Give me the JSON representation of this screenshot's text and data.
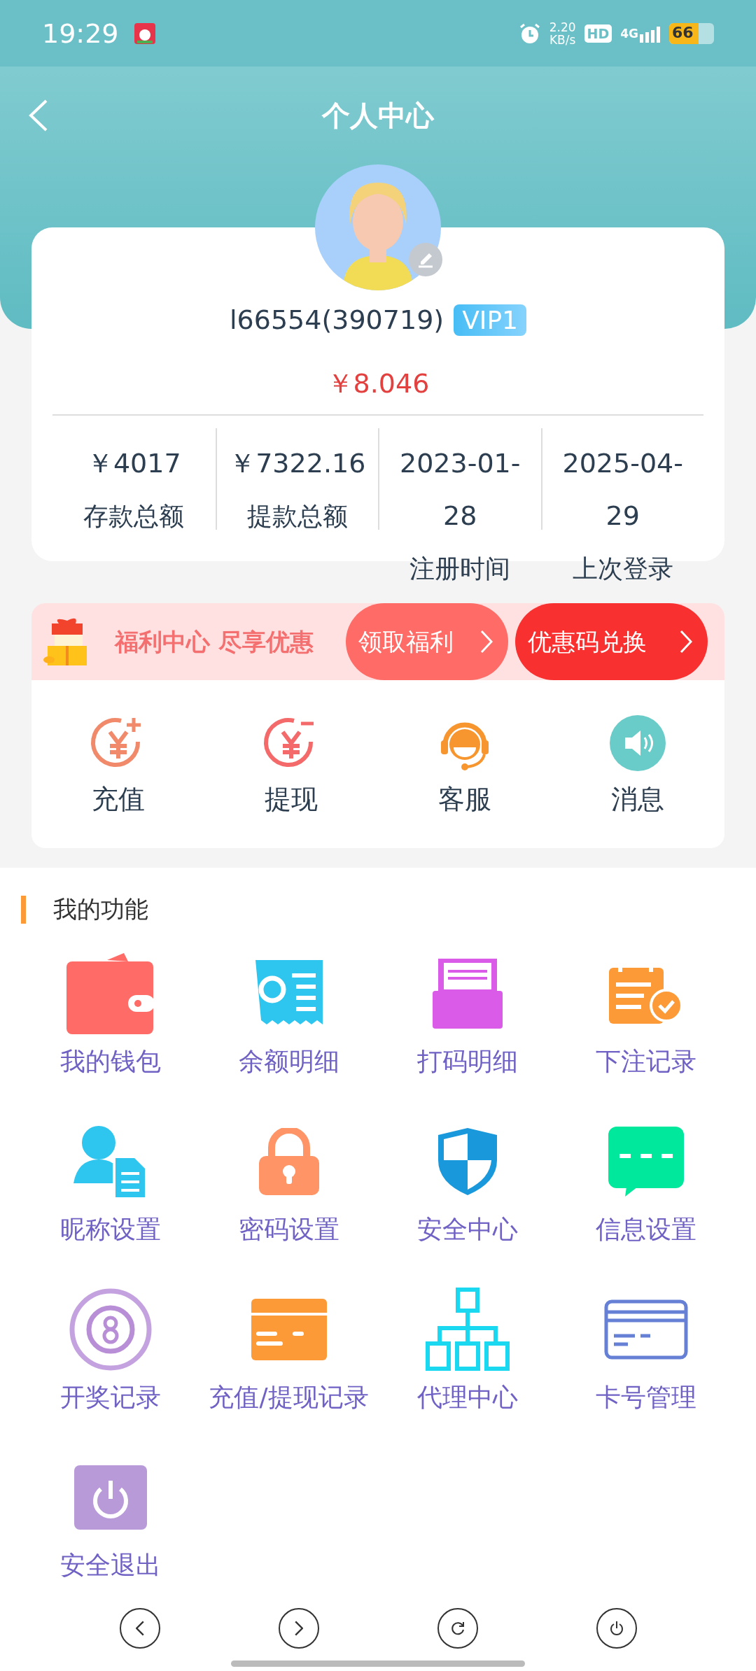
{
  "status_bar": {
    "time": "19:29",
    "speed_value": "2.20",
    "speed_unit": "KB/s",
    "hd": "HD",
    "network": "4G",
    "battery": "66"
  },
  "header": {
    "title": "个人中心"
  },
  "profile": {
    "username": "l66554(390719)",
    "vip": "VIP1",
    "balance": "￥8.046",
    "stats": [
      {
        "value": "￥4017",
        "label": "存款总额"
      },
      {
        "value": "￥7322.16",
        "label": "提款总额"
      },
      {
        "value": "2023-01-28",
        "label": "注册时间"
      },
      {
        "value": "2025-04-29",
        "label": "上次登录"
      }
    ]
  },
  "promo": {
    "text": "福利中心 尽享优惠",
    "buttons": [
      {
        "label": "领取福利",
        "color": "#ff6b66"
      },
      {
        "label": "优惠码兑换",
        "color": "#f93030"
      }
    ]
  },
  "quick_actions": [
    {
      "label": "充值"
    },
    {
      "label": "提现"
    },
    {
      "label": "客服"
    },
    {
      "label": "消息"
    }
  ],
  "functions": {
    "title": "我的功能",
    "items": [
      {
        "label": "我的钱包"
      },
      {
        "label": "余额明细"
      },
      {
        "label": "打码明细"
      },
      {
        "label": "下注记录"
      },
      {
        "label": "昵称设置"
      },
      {
        "label": "密码设置"
      },
      {
        "label": "安全中心"
      },
      {
        "label": "信息设置"
      },
      {
        "label": "开奖记录"
      },
      {
        "label": "充值/提现记录"
      },
      {
        "label": "代理中心"
      },
      {
        "label": "卡号管理"
      },
      {
        "label": "安全退出"
      }
    ]
  }
}
